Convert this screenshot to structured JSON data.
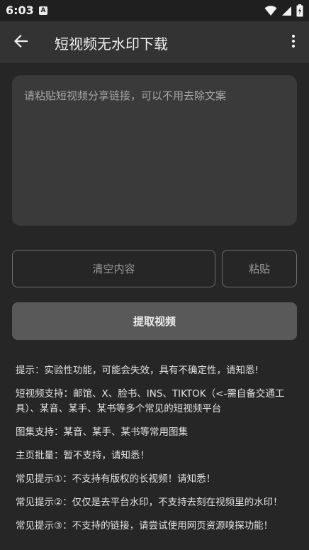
{
  "status_bar": {
    "time": "6:03",
    "app_icon_letter": "A",
    "icons": [
      "wifi-icon",
      "signal-icon",
      "battery-icon"
    ]
  },
  "app_bar": {
    "title": "短视频无水印下载",
    "back_icon": "arrow-left-icon",
    "menu_icon": "more-vertical-icon"
  },
  "input": {
    "placeholder": "请粘贴短视频分享链接，可以不用去除文案",
    "value": ""
  },
  "buttons": {
    "clear": "清空内容",
    "paste": "粘贴",
    "extract": "提取视频"
  },
  "tips": [
    "提示：实验性功能，可能会失效，具有不确定性，请知悉!",
    "短视频支持：邮馆、X、脸书、INS、TIKTOK（<-需自备交通工具）、某音、某手、某书等多个常见的短视频平台",
    "图集支持：某音、某手、某书等常用图集",
    "主页批量：暂不支持，请知悉！",
    "常见提示①：不支持有版权的长视频！请知悉！",
    "常见提示②：仅仅是去平台水印，不支持去刻在视频里的水印！",
    "常见提示③：不支持的链接，请尝试使用网页资源嗅探功能！"
  ],
  "colors": {
    "background": "#262626",
    "app_bar": "#333333",
    "input_bg": "#3a3a3a",
    "primary_button": "#595959",
    "outline": "#6e6e6e"
  }
}
